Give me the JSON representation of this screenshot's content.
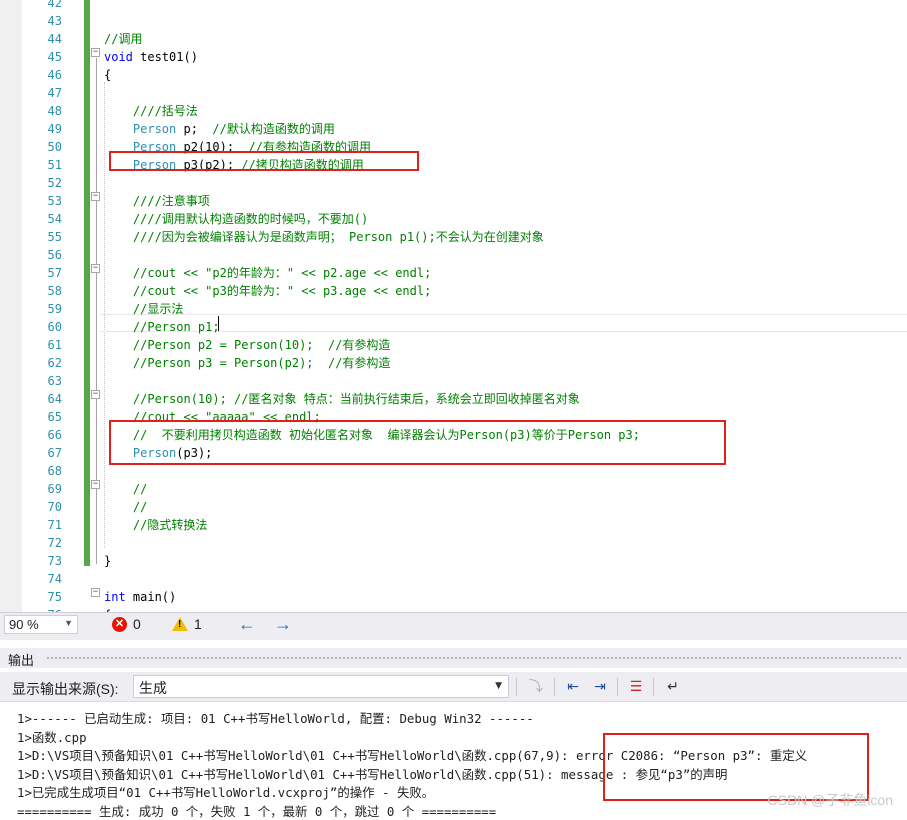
{
  "editor": {
    "line_numbers": [
      "42",
      "43",
      "44",
      "45",
      "46",
      "47",
      "48",
      "49",
      "50",
      "51",
      "52",
      "53",
      "54",
      "55",
      "56",
      "57",
      "58",
      "59",
      "60",
      "61",
      "62",
      "63",
      "64",
      "65",
      "66",
      "67",
      "68",
      "69",
      "70",
      "71",
      "72",
      "73",
      "74",
      "75",
      "76"
    ],
    "lines": [
      {
        "n": "42",
        "segs": []
      },
      {
        "n": "43",
        "segs": []
      },
      {
        "n": "44",
        "segs": [
          {
            "c": "cm",
            "t": "//调用"
          }
        ]
      },
      {
        "n": "45",
        "segs": [
          {
            "c": "kw",
            "t": "void"
          },
          {
            "c": "tx",
            "t": " test01()"
          }
        ]
      },
      {
        "n": "46",
        "segs": [
          {
            "c": "tx",
            "t": "{"
          }
        ]
      },
      {
        "n": "47",
        "segs": []
      },
      {
        "n": "48",
        "segs": [
          {
            "c": "tx",
            "t": "    "
          },
          {
            "c": "cm",
            "t": "////括号法"
          }
        ]
      },
      {
        "n": "49",
        "segs": [
          {
            "c": "tx",
            "t": "    "
          },
          {
            "c": "ty",
            "t": "Person"
          },
          {
            "c": "tx",
            "t": " p;  "
          },
          {
            "c": "cm",
            "t": "//默认构造函数的调用"
          }
        ]
      },
      {
        "n": "50",
        "segs": [
          {
            "c": "tx",
            "t": "    "
          },
          {
            "c": "ty",
            "t": "Person"
          },
          {
            "c": "tx",
            "t": " p2(10);  "
          },
          {
            "c": "cm",
            "t": "//有参构造函数的调用"
          }
        ]
      },
      {
        "n": "51",
        "segs": [
          {
            "c": "tx",
            "t": "    "
          },
          {
            "c": "ty",
            "t": "Person"
          },
          {
            "c": "tx",
            "t": " p3(p2); "
          },
          {
            "c": "cm",
            "t": "//拷贝构造函数的调用"
          }
        ]
      },
      {
        "n": "52",
        "segs": []
      },
      {
        "n": "53",
        "segs": [
          {
            "c": "tx",
            "t": "    "
          },
          {
            "c": "cm",
            "t": "////注意事项"
          }
        ]
      },
      {
        "n": "54",
        "segs": [
          {
            "c": "tx",
            "t": "    "
          },
          {
            "c": "cm",
            "t": "////调用默认构造函数的时候吗，不要加()"
          }
        ]
      },
      {
        "n": "55",
        "segs": [
          {
            "c": "tx",
            "t": "    "
          },
          {
            "c": "cm",
            "t": "////因为会被编译器认为是函数声明； Person p1();不会认为在创建对象"
          }
        ]
      },
      {
        "n": "56",
        "segs": []
      },
      {
        "n": "57",
        "segs": [
          {
            "c": "tx",
            "t": "    "
          },
          {
            "c": "cm",
            "t": "//cout << \"p2的年龄为：\" << p2.age << endl;"
          }
        ]
      },
      {
        "n": "58",
        "segs": [
          {
            "c": "tx",
            "t": "    "
          },
          {
            "c": "cm",
            "t": "//cout << \"p3的年龄为：\" << p3.age << endl;"
          }
        ]
      },
      {
        "n": "59",
        "segs": [
          {
            "c": "tx",
            "t": "    "
          },
          {
            "c": "cm",
            "t": "//显示法"
          }
        ]
      },
      {
        "n": "60",
        "segs": [
          {
            "c": "tx",
            "t": "    "
          },
          {
            "c": "cm",
            "t": "//Person p1;"
          }
        ]
      },
      {
        "n": "61",
        "segs": [
          {
            "c": "tx",
            "t": "    "
          },
          {
            "c": "cm",
            "t": "//Person p2 = Person(10);  //有参构造"
          }
        ]
      },
      {
        "n": "62",
        "segs": [
          {
            "c": "tx",
            "t": "    "
          },
          {
            "c": "cm",
            "t": "//Person p3 = Person(p2);  //有参构造"
          }
        ]
      },
      {
        "n": "63",
        "segs": []
      },
      {
        "n": "64",
        "segs": [
          {
            "c": "tx",
            "t": "    "
          },
          {
            "c": "cm",
            "t": "//Person(10); //匿名对象 特点：当前执行结束后，系统会立即回收掉匿名对象"
          }
        ]
      },
      {
        "n": "65",
        "segs": [
          {
            "c": "tx",
            "t": "    "
          },
          {
            "c": "cm",
            "t": "//cout << \"aaaaa\" << endl;"
          }
        ]
      },
      {
        "n": "66",
        "segs": [
          {
            "c": "tx",
            "t": "    "
          },
          {
            "c": "cm",
            "t": "//  不要利用拷贝构造函数 初始化匿名对象  编译器会认为Person(p3)等价于Person p3;"
          }
        ]
      },
      {
        "n": "67",
        "segs": [
          {
            "c": "tx",
            "t": "    "
          },
          {
            "c": "ty",
            "t": "Person"
          },
          {
            "c": "tx",
            "t": "(p3);"
          }
        ]
      },
      {
        "n": "68",
        "segs": []
      },
      {
        "n": "69",
        "segs": [
          {
            "c": "tx",
            "t": "    "
          },
          {
            "c": "cm",
            "t": "//"
          }
        ]
      },
      {
        "n": "70",
        "segs": [
          {
            "c": "tx",
            "t": "    "
          },
          {
            "c": "cm",
            "t": "//"
          }
        ]
      },
      {
        "n": "71",
        "segs": [
          {
            "c": "tx",
            "t": "    "
          },
          {
            "c": "cm",
            "t": "//隐式转换法"
          }
        ]
      },
      {
        "n": "72",
        "segs": []
      },
      {
        "n": "73",
        "segs": [
          {
            "c": "tx",
            "t": "}"
          }
        ]
      },
      {
        "n": "74",
        "segs": []
      },
      {
        "n": "75",
        "segs": [
          {
            "c": "kw",
            "t": "int"
          },
          {
            "c": "tx",
            "t": " main()"
          }
        ]
      },
      {
        "n": "76",
        "segs": [
          {
            "c": "tx",
            "t": "{"
          }
        ]
      }
    ]
  },
  "status": {
    "zoom": "90 %",
    "errors": "0",
    "warnings": "1"
  },
  "output": {
    "title": "输出",
    "source_label": "显示输出来源(S):",
    "source_value": "生成",
    "lines": [
      "1>------ 已启动生成: 项目: 01 C++书写HelloWorld, 配置: Debug Win32 ------",
      "1>函数.cpp",
      "1>D:\\VS项目\\预备知识\\01 C++书写HelloWorld\\01 C++书写HelloWorld\\函数.cpp(67,9): error C2086: “Person p3”: 重定义",
      "1>D:\\VS项目\\预备知识\\01 C++书写HelloWorld\\01 C++书写HelloWorld\\函数.cpp(51): message : 参见“p3”的声明",
      "1>已完成生成项目“01 C++书写HelloWorld.vcxproj”的操作 - 失败。",
      "========== 生成: 成功 0 个，失败 1 个，最新 0 个，跳过 0 个 =========="
    ]
  },
  "watermark": "CSDN @子非鱼icon",
  "colors": {
    "comment": "#008000",
    "keyword": "#0000ff",
    "type": "#2b91af",
    "line_number": "#2b91af",
    "change_bar": "#57a64a",
    "highlight_box": "#e0201a"
  }
}
